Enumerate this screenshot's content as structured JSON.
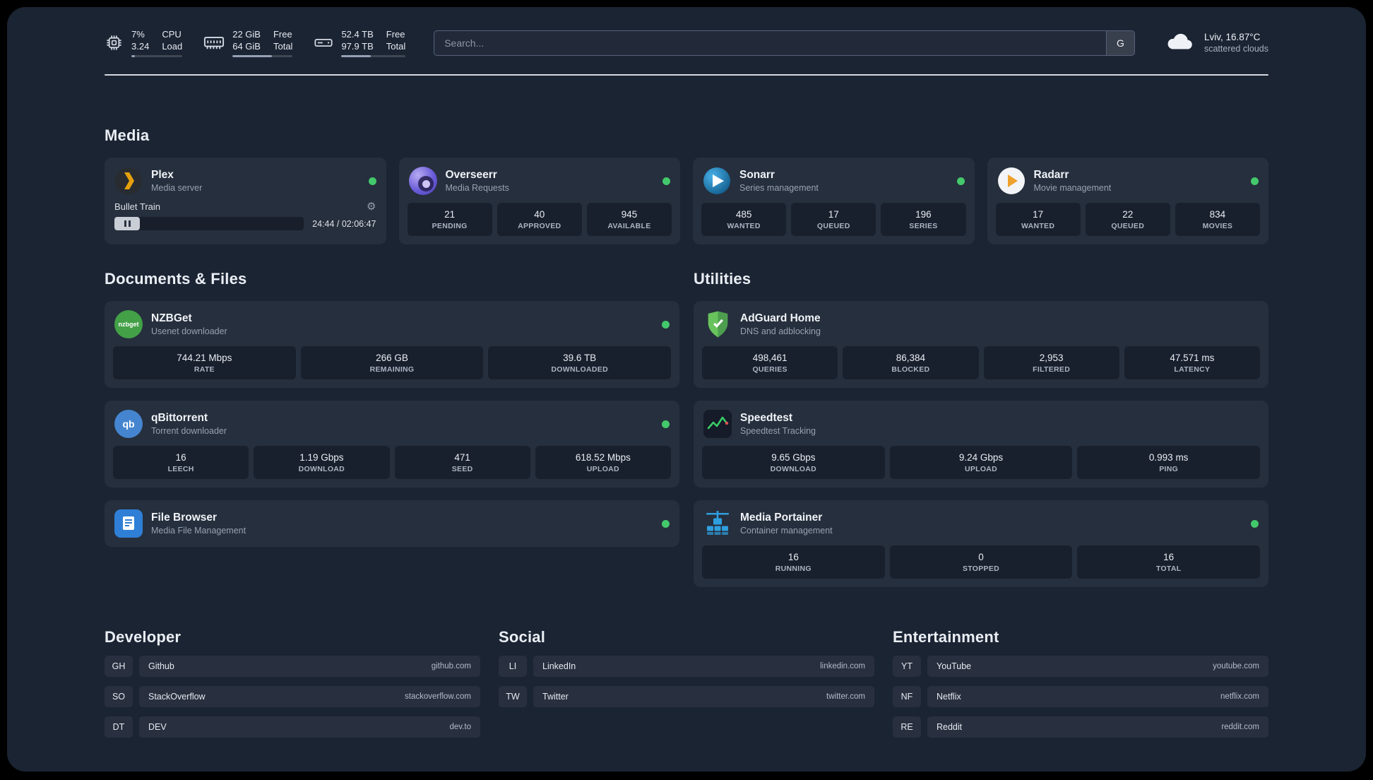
{
  "topbar": {
    "cpu": {
      "percent": "7%",
      "load": "3.24",
      "label_top": "CPU",
      "label_bottom": "Load",
      "bar_percent": 7
    },
    "memory": {
      "free": "22 GiB",
      "total": "64 GiB",
      "label_top": "Free",
      "label_bottom": "Total",
      "bar_percent": 66
    },
    "disk": {
      "free": "52.4 TB",
      "total": "97.9 TB",
      "label_top": "Free",
      "label_bottom": "Total",
      "bar_percent": 46
    },
    "search": {
      "placeholder": "Search...",
      "provider_label": "G"
    },
    "weather": {
      "location": "Lviv, 16.87°C",
      "condition": "scattered clouds"
    }
  },
  "media": {
    "title": "Media",
    "plex": {
      "title": "Plex",
      "subtitle": "Media server",
      "now_playing": "Bullet Train",
      "time": "24:44 / 02:06:47",
      "progress_percent": 19
    },
    "overseerr": {
      "title": "Overseerr",
      "subtitle": "Media Requests",
      "stats": [
        {
          "value": "21",
          "label": "PENDING"
        },
        {
          "value": "40",
          "label": "APPROVED"
        },
        {
          "value": "945",
          "label": "AVAILABLE"
        }
      ]
    },
    "sonarr": {
      "title": "Sonarr",
      "subtitle": "Series management",
      "stats": [
        {
          "value": "485",
          "label": "WANTED"
        },
        {
          "value": "17",
          "label": "QUEUED"
        },
        {
          "value": "196",
          "label": "SERIES"
        }
      ]
    },
    "radarr": {
      "title": "Radarr",
      "subtitle": "Movie management",
      "stats": [
        {
          "value": "17",
          "label": "WANTED"
        },
        {
          "value": "22",
          "label": "QUEUED"
        },
        {
          "value": "834",
          "label": "MOVIES"
        }
      ]
    }
  },
  "documents": {
    "title": "Documents & Files",
    "nzbget": {
      "title": "NZBGet",
      "subtitle": "Usenet downloader",
      "stats": [
        {
          "value": "744.21 Mbps",
          "label": "RATE"
        },
        {
          "value": "266 GB",
          "label": "REMAINING"
        },
        {
          "value": "39.6 TB",
          "label": "DOWNLOADED"
        }
      ]
    },
    "qbittorrent": {
      "title": "qBittorrent",
      "subtitle": "Torrent downloader",
      "stats": [
        {
          "value": "16",
          "label": "LEECH"
        },
        {
          "value": "1.19 Gbps",
          "label": "DOWNLOAD"
        },
        {
          "value": "471",
          "label": "SEED"
        },
        {
          "value": "618.52 Mbps",
          "label": "UPLOAD"
        }
      ]
    },
    "filebrowser": {
      "title": "File Browser",
      "subtitle": "Media File Management"
    }
  },
  "utilities": {
    "title": "Utilities",
    "adguard": {
      "title": "AdGuard Home",
      "subtitle": "DNS and adblocking",
      "stats": [
        {
          "value": "498,461",
          "label": "QUERIES"
        },
        {
          "value": "86,384",
          "label": "BLOCKED"
        },
        {
          "value": "2,953",
          "label": "FILTERED"
        },
        {
          "value": "47.571 ms",
          "label": "LATENCY"
        }
      ]
    },
    "speedtest": {
      "title": "Speedtest",
      "subtitle": "Speedtest Tracking",
      "stats": [
        {
          "value": "9.65 Gbps",
          "label": "DOWNLOAD"
        },
        {
          "value": "9.24 Gbps",
          "label": "UPLOAD"
        },
        {
          "value": "0.993 ms",
          "label": "PING"
        }
      ]
    },
    "portainer": {
      "title": "Media Portainer",
      "subtitle": "Container management",
      "stats": [
        {
          "value": "16",
          "label": "RUNNING"
        },
        {
          "value": "0",
          "label": "STOPPED"
        },
        {
          "value": "16",
          "label": "TOTAL"
        }
      ]
    }
  },
  "bookmarks": {
    "developer": {
      "title": "Developer",
      "items": [
        {
          "abbr": "GH",
          "name": "Github",
          "domain": "github.com"
        },
        {
          "abbr": "SO",
          "name": "StackOverflow",
          "domain": "stackoverflow.com"
        },
        {
          "abbr": "DT",
          "name": "DEV",
          "domain": "dev.to"
        }
      ]
    },
    "social": {
      "title": "Social",
      "items": [
        {
          "abbr": "LI",
          "name": "LinkedIn",
          "domain": "linkedin.com"
        },
        {
          "abbr": "TW",
          "name": "Twitter",
          "domain": "twitter.com"
        }
      ]
    },
    "entertainment": {
      "title": "Entertainment",
      "items": [
        {
          "abbr": "YT",
          "name": "YouTube",
          "domain": "youtube.com"
        },
        {
          "abbr": "NF",
          "name": "Netflix",
          "domain": "netflix.com"
        },
        {
          "abbr": "RE",
          "name": "Reddit",
          "domain": "reddit.com"
        }
      ]
    }
  },
  "icons": {
    "nzbget_text": "nzbget",
    "qbittorrent_text": "qb"
  },
  "colors": {
    "status_online": "#43c96b",
    "plex_amber": "#e5a00d",
    "adguard_green": "#62bd5f",
    "portainer_blue": "#2f9fe0",
    "speedtest_green": "#37d068"
  }
}
